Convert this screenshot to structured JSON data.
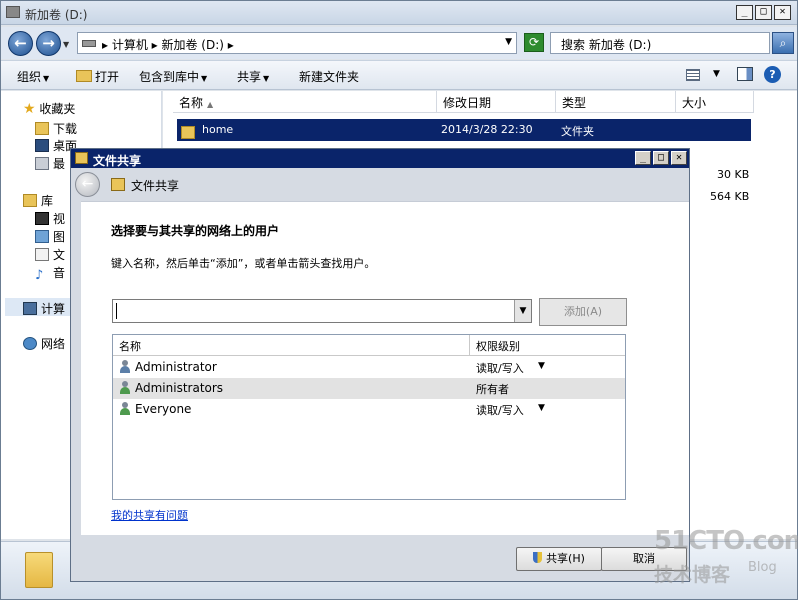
{
  "explorer": {
    "title": "新加卷 (D:)",
    "address": "▸ 计算机 ▸ 新加卷 (D:) ▸",
    "search_placeholder": "搜索 新加卷 (D:)",
    "toolbar": {
      "organize": "组织",
      "open": "打开",
      "include_in_library": "包含到库中",
      "share": "共享",
      "new_folder": "新建文件夹"
    },
    "nav": {
      "favorites": "收藏夹",
      "downloads": "下载",
      "desktop": "桌面",
      "recent": "最",
      "libraries": "库",
      "videos": "视",
      "pictures": "图",
      "documents": "文",
      "music": "音",
      "computer": "计算",
      "network": "网络"
    },
    "columns": {
      "name": "名称",
      "modified": "修改日期",
      "type": "类型",
      "size": "大小"
    },
    "rows": [
      {
        "name": "home",
        "modified": "2014/3/28 22:30",
        "type": "文件夹",
        "size": ""
      }
    ],
    "sizes": [
      "30 KB",
      "564 KB"
    ]
  },
  "dialog": {
    "title": "文件共享",
    "header": "文件共享",
    "heading": "选择要与其共享的网络上的用户",
    "subtext": "键入名称，然后单击“添加”，或者单击箭头查找用户。",
    "input_value": "",
    "add_button": "添加(A)",
    "columns": {
      "name": "名称",
      "permission": "权限级别"
    },
    "users": [
      {
        "name": "Administrator",
        "permission": "读取/写入",
        "icon": "user-icon"
      },
      {
        "name": "Administrators",
        "permission": "所有者",
        "icon": "group-icon"
      },
      {
        "name": "Everyone",
        "permission": "读取/写入",
        "icon": "group-icon"
      }
    ],
    "help_link": "我的共享有问题",
    "share_button": "共享(H)",
    "cancel_button": "取消"
  },
  "watermark": {
    "main": "51CTO.com",
    "sub": "技术博客",
    "blog": "Blog"
  }
}
